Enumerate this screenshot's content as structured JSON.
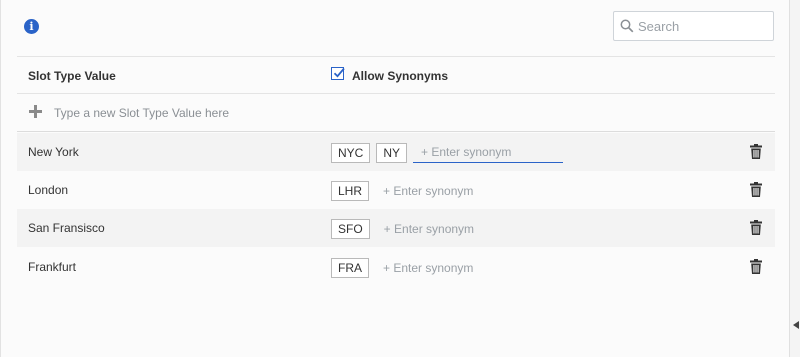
{
  "search": {
    "placeholder": "Search"
  },
  "table": {
    "col_value": "Slot Type Value",
    "col_synonyms": "Allow Synonyms",
    "allow_synonyms_checked": true,
    "new_value_placeholder": "Type a new Slot Type Value here",
    "synonym_placeholder": "+ Enter synonym",
    "rows": [
      {
        "value": "New York",
        "synonyms": [
          "NYC",
          "NY"
        ]
      },
      {
        "value": "London",
        "synonyms": [
          "LHR"
        ]
      },
      {
        "value": "San Fransisco",
        "synonyms": [
          "SFO"
        ]
      },
      {
        "value": "Frankfurt",
        "synonyms": [
          "FRA"
        ]
      }
    ]
  },
  "icons": {
    "info": "info-icon",
    "search": "search-icon",
    "add": "plus-icon",
    "delete": "trash-icon",
    "collapse": "collapse-arrow-icon"
  },
  "colors": {
    "accent": "#2a63c8",
    "row_shade": "#f3f3f3",
    "chip_border": "#b9b9b9"
  }
}
